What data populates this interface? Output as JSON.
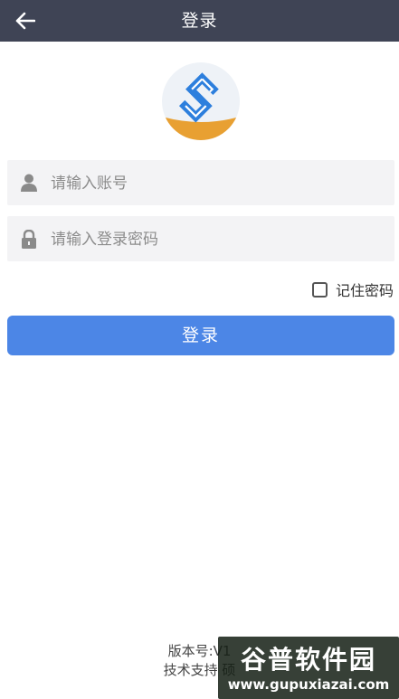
{
  "header": {
    "title": "登录",
    "back_icon": "arrow-left-icon"
  },
  "logo": {
    "icon": "app-logo-s",
    "colors": {
      "blue": "#2d7fdd",
      "orange": "#e8a032",
      "bg": "#eef2f7"
    }
  },
  "form": {
    "account": {
      "placeholder": "请输入账号",
      "value": "",
      "icon": "user-icon"
    },
    "password": {
      "placeholder": "请输入登录密码",
      "value": "",
      "icon": "lock-icon"
    },
    "remember_label": "记住密码",
    "remember_checked": false,
    "submit_label": "登录"
  },
  "footer": {
    "version_text": "版本号:V1",
    "support_text": "技术支持  硕"
  },
  "watermark": {
    "title": "谷普软件园",
    "url": "www.gupuxiazai.com"
  },
  "colors": {
    "topbar": "#3f4455",
    "primary": "#4c86e6",
    "field_bg": "#f3f3f5"
  }
}
